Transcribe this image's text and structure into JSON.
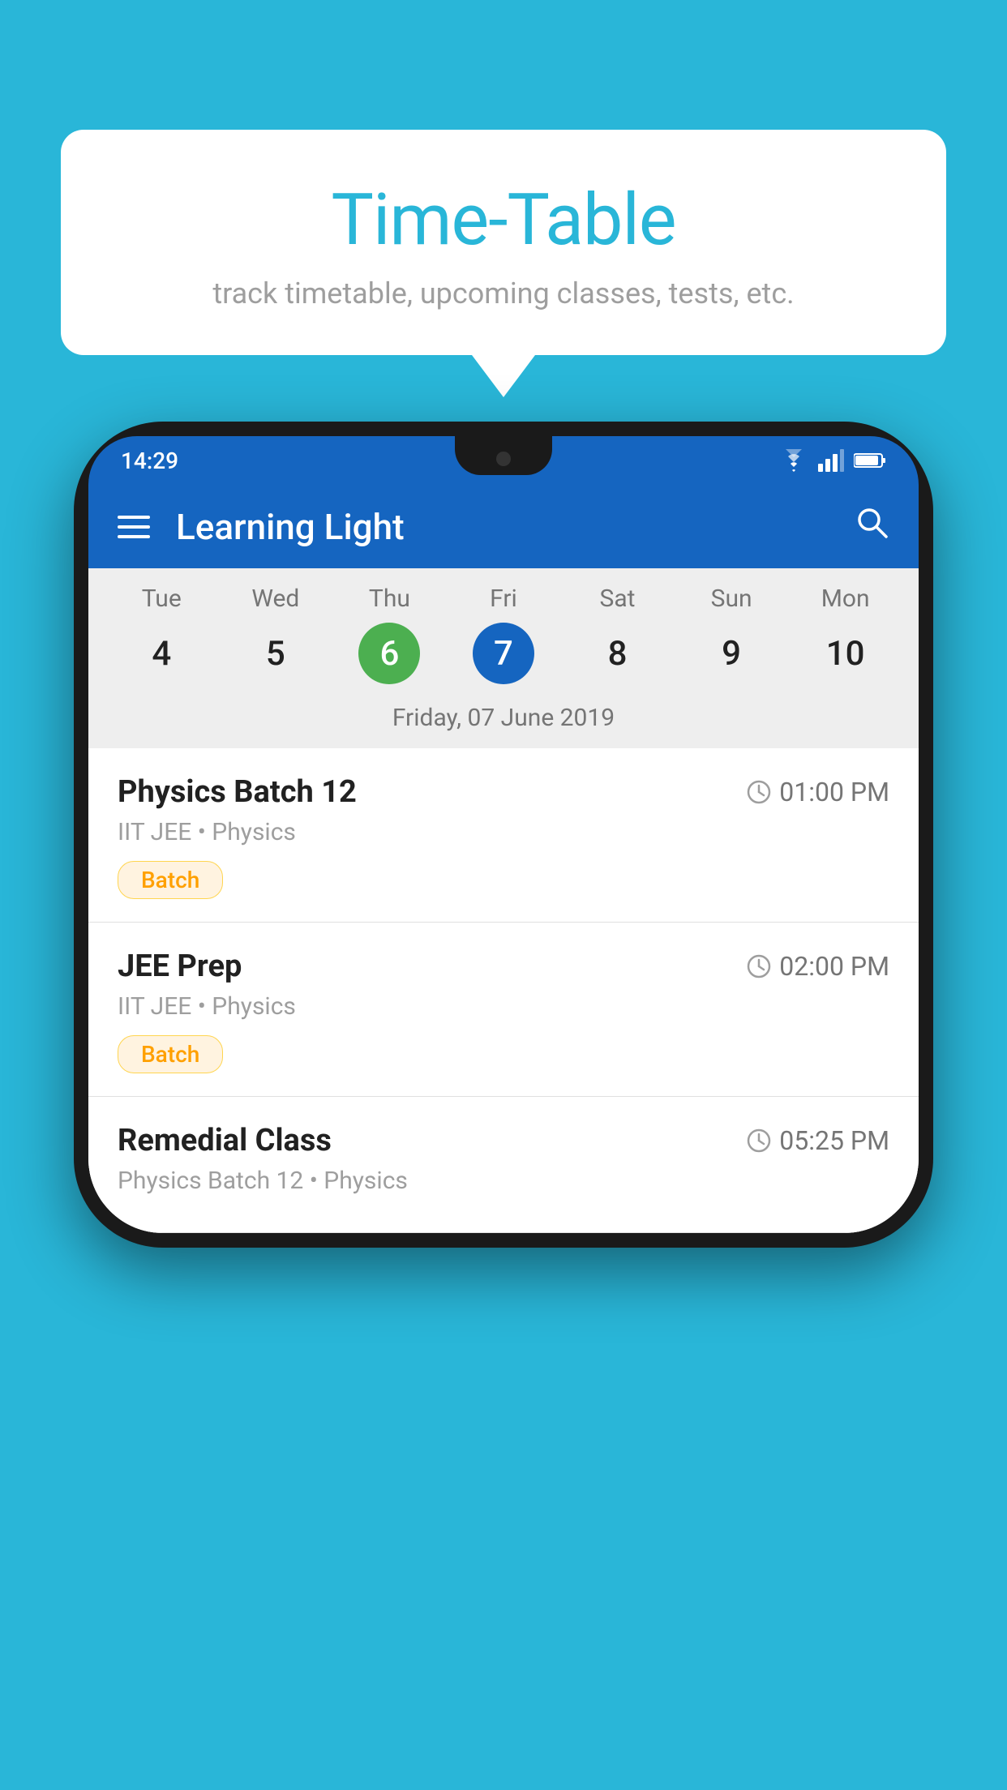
{
  "background_color": "#29B6D8",
  "bubble": {
    "title": "Time-Table",
    "subtitle": "track timetable, upcoming classes, tests, etc."
  },
  "phone": {
    "status_bar": {
      "time": "14:29",
      "icons": [
        "wifi",
        "signal",
        "battery"
      ]
    },
    "app_bar": {
      "title": "Learning Light",
      "search_label": "search"
    },
    "calendar": {
      "days": [
        {
          "name": "Tue",
          "number": "4",
          "state": "normal"
        },
        {
          "name": "Wed",
          "number": "5",
          "state": "normal"
        },
        {
          "name": "Thu",
          "number": "6",
          "state": "today"
        },
        {
          "name": "Fri",
          "number": "7",
          "state": "selected"
        },
        {
          "name": "Sat",
          "number": "8",
          "state": "normal"
        },
        {
          "name": "Sun",
          "number": "9",
          "state": "normal"
        },
        {
          "name": "Mon",
          "number": "10",
          "state": "normal"
        }
      ],
      "selected_date_label": "Friday, 07 June 2019"
    },
    "schedule": [
      {
        "title": "Physics Batch 12",
        "time": "01:00 PM",
        "subtitle": "IIT JEE • Physics",
        "badge": "Batch"
      },
      {
        "title": "JEE Prep",
        "time": "02:00 PM",
        "subtitle": "IIT JEE • Physics",
        "badge": "Batch"
      },
      {
        "title": "Remedial Class",
        "time": "05:25 PM",
        "subtitle": "Physics Batch 12 • Physics",
        "badge": null
      }
    ]
  }
}
